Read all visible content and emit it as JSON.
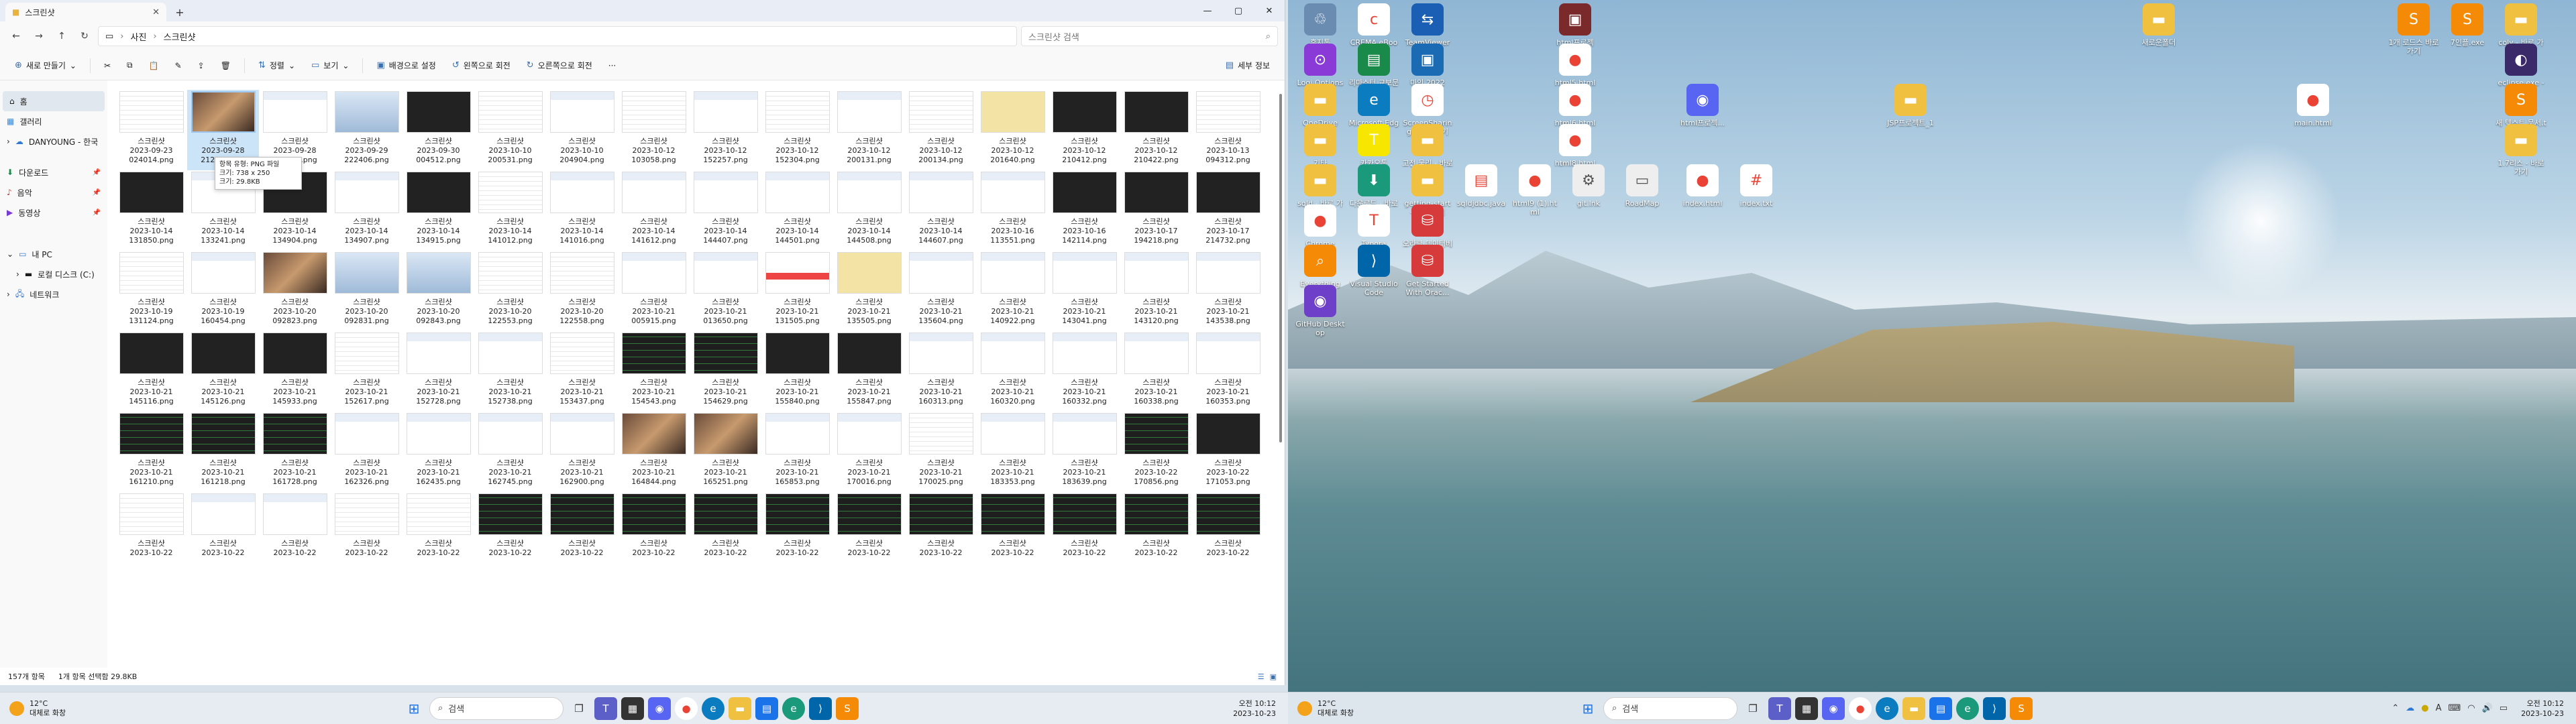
{
  "explorer": {
    "tab_title": "스크린샷",
    "new_tab": "+",
    "path": [
      "사진",
      "스크린샷"
    ],
    "search_placeholder": "스크린샷 검색",
    "toolbar": {
      "new": "새로 만들기",
      "sort": "정렬",
      "view": "보기",
      "set_background": "배경으로 설정",
      "rotate_left": "왼쪽으로 회전",
      "rotate_right": "오른쪽으로 회전",
      "more": "···",
      "details": "세부 정보"
    },
    "sidebar": {
      "home": "홈",
      "gallery": "갤러리",
      "onedrive": "DANYOUNG - 한국",
      "downloads": "다운로드",
      "music": "음악",
      "videos": "동영상",
      "this_pc": "내 PC",
      "local_disk": "로컬 디스크 (C:)",
      "network": "네트워크"
    },
    "tooltip": [
      "항목 유형: PNG 파일",
      "크기: 738 x 250",
      "크기: 29.8KB"
    ],
    "files": [
      [
        "스크린샷",
        "2023-09-23",
        "024014.png"
      ],
      [
        "스크린샷",
        "2023-09-28",
        "212538.png"
      ],
      [
        "스크린샷",
        "2023-09-28",
        "222406.png"
      ],
      [
        "스크린샷",
        "2023-09-29",
        "222406.png"
      ],
      [
        "스크린샷",
        "2023-09-30",
        "004512.png"
      ],
      [
        "스크린샷",
        "2023-10-10",
        "200531.png"
      ],
      [
        "스크린샷",
        "2023-10-10",
        "204904.png"
      ],
      [
        "스크린샷",
        "2023-10-12",
        "103058.png"
      ],
      [
        "스크린샷",
        "2023-10-12",
        "152257.png"
      ],
      [
        "스크린샷",
        "2023-10-12",
        "152304.png"
      ],
      [
        "스크린샷",
        "2023-10-12",
        "200131.png"
      ],
      [
        "스크린샷",
        "2023-10-12",
        "200134.png"
      ],
      [
        "스크린샷",
        "2023-10-12",
        "201640.png"
      ],
      [
        "스크린샷",
        "2023-10-12",
        "210412.png"
      ],
      [
        "스크린샷",
        "2023-10-12",
        "210422.png"
      ],
      [
        "스크린샷",
        "2023-10-13",
        "094312.png"
      ],
      [
        "스크린샷",
        "2023-10-14",
        "131850.png"
      ],
      [
        "스크린샷",
        "2023-10-14",
        "133241.png"
      ],
      [
        "스크린샷",
        "2023-10-14",
        "134904.png"
      ],
      [
        "스크린샷",
        "2023-10-14",
        "134907.png"
      ],
      [
        "스크린샷",
        "2023-10-14",
        "134915.png"
      ],
      [
        "스크린샷",
        "2023-10-14",
        "141012.png"
      ],
      [
        "스크린샷",
        "2023-10-14",
        "141016.png"
      ],
      [
        "스크린샷",
        "2023-10-14",
        "141612.png"
      ],
      [
        "스크린샷",
        "2023-10-14",
        "144407.png"
      ],
      [
        "스크린샷",
        "2023-10-14",
        "144501.png"
      ],
      [
        "스크린샷",
        "2023-10-14",
        "144508.png"
      ],
      [
        "스크린샷",
        "2023-10-14",
        "144607.png"
      ],
      [
        "스크린샷",
        "2023-10-16",
        "113551.png"
      ],
      [
        "스크린샷",
        "2023-10-16",
        "142114.png"
      ],
      [
        "스크린샷",
        "2023-10-17",
        "194218.png"
      ],
      [
        "스크린샷",
        "2023-10-17",
        "214732.png"
      ],
      [
        "스크린샷",
        "2023-10-19",
        "131124.png"
      ],
      [
        "스크린샷",
        "2023-10-19",
        "160454.png"
      ],
      [
        "스크린샷",
        "2023-10-20",
        "092823.png"
      ],
      [
        "스크린샷",
        "2023-10-20",
        "092831.png"
      ],
      [
        "스크린샷",
        "2023-10-20",
        "092843.png"
      ],
      [
        "스크린샷",
        "2023-10-20",
        "122553.png"
      ],
      [
        "스크린샷",
        "2023-10-20",
        "122558.png"
      ],
      [
        "스크린샷",
        "2023-10-21",
        "005915.png"
      ],
      [
        "스크린샷",
        "2023-10-21",
        "013650.png"
      ],
      [
        "스크린샷",
        "2023-10-21",
        "131505.png"
      ],
      [
        "스크린샷",
        "2023-10-21",
        "135505.png"
      ],
      [
        "스크린샷",
        "2023-10-21",
        "135604.png"
      ],
      [
        "스크린샷",
        "2023-10-21",
        "140922.png"
      ],
      [
        "스크린샷",
        "2023-10-21",
        "143041.png"
      ],
      [
        "스크린샷",
        "2023-10-21",
        "143120.png"
      ],
      [
        "스크린샷",
        "2023-10-21",
        "143538.png"
      ],
      [
        "스크린샷",
        "2023-10-21",
        "145116.png"
      ],
      [
        "스크린샷",
        "2023-10-21",
        "145126.png"
      ],
      [
        "스크린샷",
        "2023-10-21",
        "145933.png"
      ],
      [
        "스크린샷",
        "2023-10-21",
        "152617.png"
      ],
      [
        "스크린샷",
        "2023-10-21",
        "152728.png"
      ],
      [
        "스크린샷",
        "2023-10-21",
        "152738.png"
      ],
      [
        "스크린샷",
        "2023-10-21",
        "153437.png"
      ],
      [
        "스크린샷",
        "2023-10-21",
        "154543.png"
      ],
      [
        "스크린샷",
        "2023-10-21",
        "154629.png"
      ],
      [
        "스크린샷",
        "2023-10-21",
        "155840.png"
      ],
      [
        "스크린샷",
        "2023-10-21",
        "155847.png"
      ],
      [
        "스크린샷",
        "2023-10-21",
        "160313.png"
      ],
      [
        "스크린샷",
        "2023-10-21",
        "160320.png"
      ],
      [
        "스크린샷",
        "2023-10-21",
        "160332.png"
      ],
      [
        "스크린샷",
        "2023-10-21",
        "160338.png"
      ],
      [
        "스크린샷",
        "2023-10-21",
        "160353.png"
      ],
      [
        "스크린샷",
        "2023-10-21",
        "161210.png"
      ],
      [
        "스크린샷",
        "2023-10-21",
        "161218.png"
      ],
      [
        "스크린샷",
        "2023-10-21",
        "161728.png"
      ],
      [
        "스크린샷",
        "2023-10-21",
        "162326.png"
      ],
      [
        "스크린샷",
        "2023-10-21",
        "162435.png"
      ],
      [
        "스크린샷",
        "2023-10-21",
        "162745.png"
      ],
      [
        "스크린샷",
        "2023-10-21",
        "162900.png"
      ],
      [
        "스크린샷",
        "2023-10-21",
        "164844.png"
      ],
      [
        "스크린샷",
        "2023-10-21",
        "165251.png"
      ],
      [
        "스크린샷",
        "2023-10-21",
        "165853.png"
      ],
      [
        "스크린샷",
        "2023-10-21",
        "170016.png"
      ],
      [
        "스크린샷",
        "2023-10-21",
        "170025.png"
      ],
      [
        "스크린샷",
        "2023-10-21",
        "183353.png"
      ],
      [
        "스크린샷",
        "2023-10-21",
        "183639.png"
      ],
      [
        "스크린샷",
        "2023-10-22",
        "170856.png"
      ],
      [
        "스크린샷",
        "2023-10-22",
        "171053.png"
      ],
      [
        "스크린샷",
        "2023-10-22",
        ""
      ],
      [
        "스크린샷",
        "2023-10-22",
        ""
      ],
      [
        "스크린샷",
        "2023-10-22",
        ""
      ],
      [
        "스크린샷",
        "2023-10-22",
        ""
      ],
      [
        "스크린샷",
        "2023-10-22",
        ""
      ],
      [
        "스크린샷",
        "2023-10-22",
        ""
      ],
      [
        "스크린샷",
        "2023-10-22",
        ""
      ],
      [
        "스크린샷",
        "2023-10-22",
        ""
      ],
      [
        "스크린샷",
        "2023-10-22",
        ""
      ],
      [
        "스크린샷",
        "2023-10-22",
        ""
      ],
      [
        "스크린샷",
        "2023-10-22",
        ""
      ],
      [
        "스크린샷",
        "2023-10-22",
        ""
      ],
      [
        "스크린샷",
        "2023-10-22",
        ""
      ],
      [
        "스크린샷",
        "2023-10-22",
        ""
      ],
      [
        "스크린샷",
        "2023-10-22",
        ""
      ],
      [
        "스크린샷",
        "2023-10-22",
        ""
      ]
    ],
    "status_count": "157개 항목",
    "status_selected": "1개 항목 선택함 29.8KB"
  },
  "taskbar1": {
    "temp": "12°C",
    "weather": "대체로 화창",
    "search": "검색",
    "time": "오전 10:12",
    "date": "2023-10-23"
  },
  "taskbar2": {
    "temp": "12°C",
    "weather": "대체로 화창",
    "search": "검색",
    "time": "오전 10:12",
    "date": "2023-10-23"
  },
  "desktop_icons": [
    "휴지통",
    "CREMA eBook",
    "TeamViewer",
    "html프로젝트...",
    "새로운폴더",
    "1개 로드스 바로가기",
    "7인플.exe",
    "coly - 바로 가기",
    "Logi Options+",
    "리마스터 교보문고...",
    "마인 2022",
    "html5.html",
    "eclipse.exe - 바로 가기",
    "OneDrive",
    "Microsoft Edge",
    "ScreenSharing - 바로 가기",
    "html6.html",
    "html프로젝...",
    "JSP프로젝트_1",
    "main.html",
    "새 텍스트 문서.txt",
    "기타",
    "카카오톡",
    "고전 물리 - 바로 가기",
    "html8.html",
    "1.7리스 - 바로 가기",
    "sqld - 바로 가기",
    "다운로드 - 바로 가기",
    "getting-start - 바로 가기",
    "sqldjdbc.java",
    "html9 (1).html",
    "git.lnk",
    "RoadMap",
    "index.html",
    "index.txt",
    "Chrome",
    "Typora",
    "오라클 데이터베이스",
    "Everything",
    "Visual Studio Code",
    "Get Started With Orac...",
    "GitHub Desktop"
  ]
}
